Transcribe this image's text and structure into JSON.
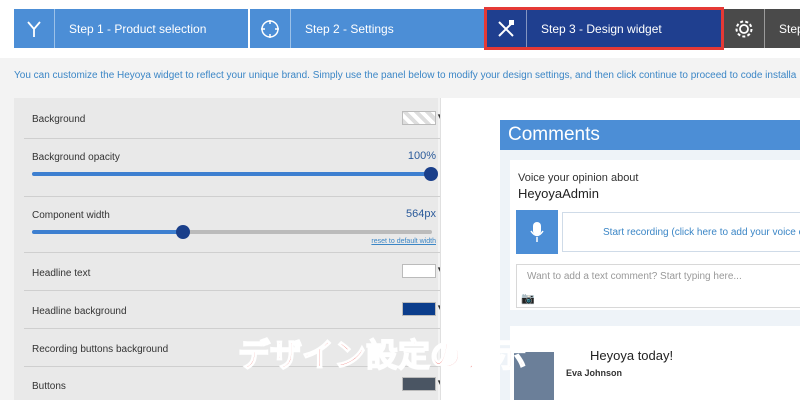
{
  "wizard": {
    "steps": [
      {
        "label": "Step 1 - Product selection",
        "icon": "fork-icon"
      },
      {
        "label": "Step 2 - Settings",
        "icon": "crosshair-icon"
      },
      {
        "label": "Step 3 - Design widget",
        "icon": "design-tools-icon",
        "active": true
      },
      {
        "label": "Step",
        "icon": "gear-icon"
      }
    ]
  },
  "intro_text": "You can customize the Heyoya widget to reflect your unique brand. Simply use the panel below to modify your design settings, and then click continue to proceed to code installa",
  "design_panel": {
    "background_label": "Background",
    "opacity_label": "Background opacity",
    "opacity_value": "100%",
    "opacity_fraction": 1.0,
    "width_label": "Component width",
    "width_value": "564px",
    "width_fraction": 0.4,
    "reset_link": "reset to default width",
    "headline_text_label": "Headline text",
    "headline_text_color": "#ffffff",
    "headline_bg_label": "Headline background",
    "headline_bg_color": "#0b3d8c",
    "recording_bg_label": "Recording buttons background",
    "buttons_label": "Buttons",
    "buttons_color": "#4a5563"
  },
  "preview": {
    "header": "Comments",
    "voice_prompt": "Voice your opinion about",
    "username": "HeyoyaAdmin",
    "record_text": "Start recording (click here to add your voice co",
    "text_placeholder": "Want to add a text comment? Start typing here...",
    "comment_title": "Heyoya today!",
    "comment_author": "Eva Johnson"
  },
  "overlay_caption": "デザイン設定の表示",
  "colors": {
    "step_blue": "#4c8ed6",
    "step_active": "#1f3f8f",
    "highlight_red": "#e53935"
  }
}
